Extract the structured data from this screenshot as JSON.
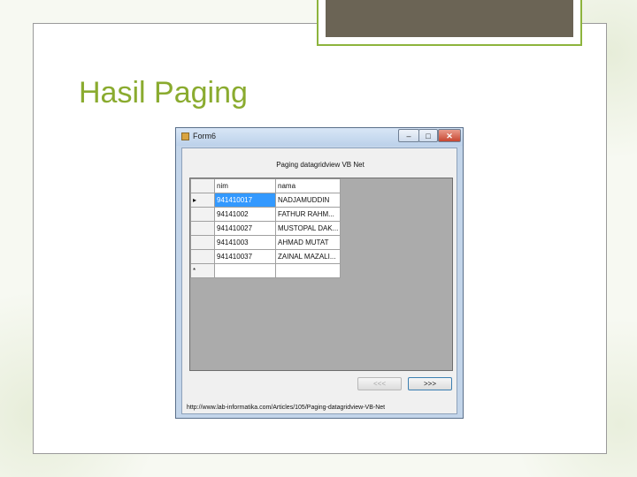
{
  "slide": {
    "title": "Hasil Paging"
  },
  "window": {
    "title": "Form6",
    "controls": {
      "minimize": "–",
      "maximize": "□",
      "close": "✕"
    },
    "form_label": "Paging datagridview VB Net",
    "grid": {
      "columns": [
        "nim",
        "nama"
      ],
      "rows": [
        {
          "indicator": "▸",
          "nim": "941410017",
          "nama": "NADJAMUDDIN",
          "selected": true
        },
        {
          "indicator": "",
          "nim": "94141002",
          "nama": "FATHUR RAHM..."
        },
        {
          "indicator": "",
          "nim": "941410027",
          "nama": "MUSTOPAL DAK..."
        },
        {
          "indicator": "",
          "nim": "94141003",
          "nama": "AHMAD MUTAT"
        },
        {
          "indicator": "",
          "nim": "941410037",
          "nama": "ZAINAL MAZALI..."
        }
      ],
      "new_row_indicator": "*"
    },
    "buttons": {
      "prev": "<<<",
      "next": ">>>"
    },
    "footer_link": "http://www.lab-informatika.com/Articles/105/Paging-datagridview-VB-Net"
  },
  "colors": {
    "title": "#8aab2f",
    "accent_border": "#8db43d",
    "accent_fill": "#6b6455",
    "selection": "#3399ff"
  }
}
